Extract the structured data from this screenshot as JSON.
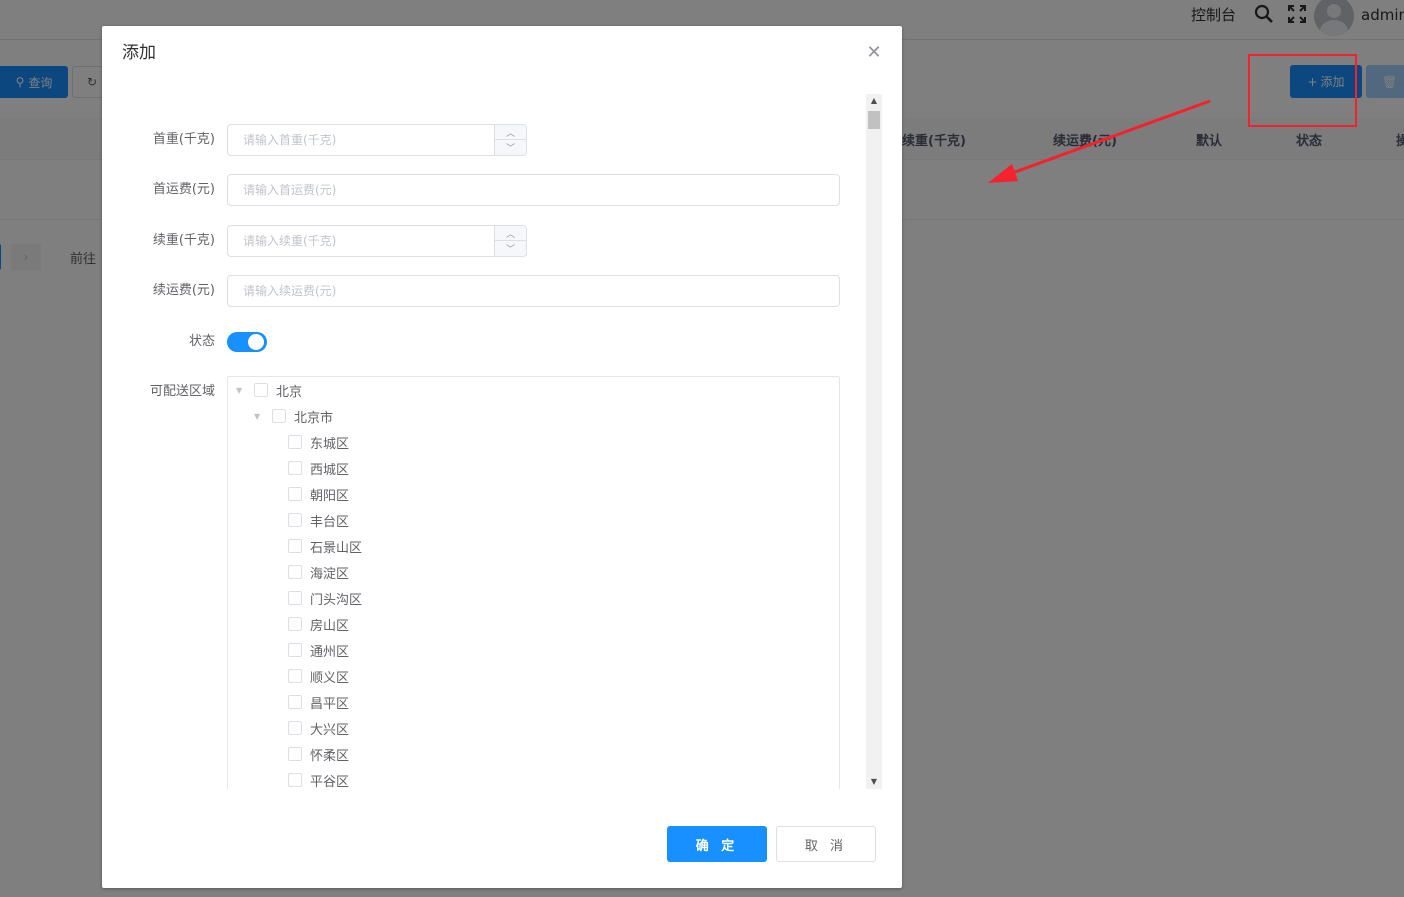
{
  "topbar": {
    "console": "控制台",
    "username": "admin"
  },
  "toolbar": {
    "query_label": "查询",
    "reset_icon": "refresh-icon",
    "add_label": "添加",
    "delete_label": "删"
  },
  "table": {
    "headers": [
      "续重(千克)",
      "续运费(元)",
      "默认",
      "状态",
      "操"
    ]
  },
  "pagination": {
    "goto_label": "前往"
  },
  "dialog": {
    "title": "添加",
    "fields": {
      "first_weight": {
        "label": "首重(千克)",
        "placeholder": "请输入首重(千克)"
      },
      "first_fee": {
        "label": "首运费(元)",
        "placeholder": "请输入首运费(元)"
      },
      "extra_weight": {
        "label": "续重(千克)",
        "placeholder": "请输入续重(千克)"
      },
      "extra_fee": {
        "label": "续运费(元)",
        "placeholder": "请输入续运费(元)"
      },
      "status": {
        "label": "状态",
        "value": true
      },
      "regions": {
        "label": "可配送区域"
      }
    },
    "tree": {
      "province": "北京",
      "city": "北京市",
      "districts": [
        "东城区",
        "西城区",
        "朝阳区",
        "丰台区",
        "石景山区",
        "海淀区",
        "门头沟区",
        "房山区",
        "通州区",
        "顺义区",
        "昌平区",
        "大兴区",
        "怀柔区",
        "平谷区"
      ]
    },
    "confirm_label": "确 定",
    "cancel_label": "取 消"
  },
  "colors": {
    "primary": "#1890ff",
    "annotation": "#f5222d"
  }
}
